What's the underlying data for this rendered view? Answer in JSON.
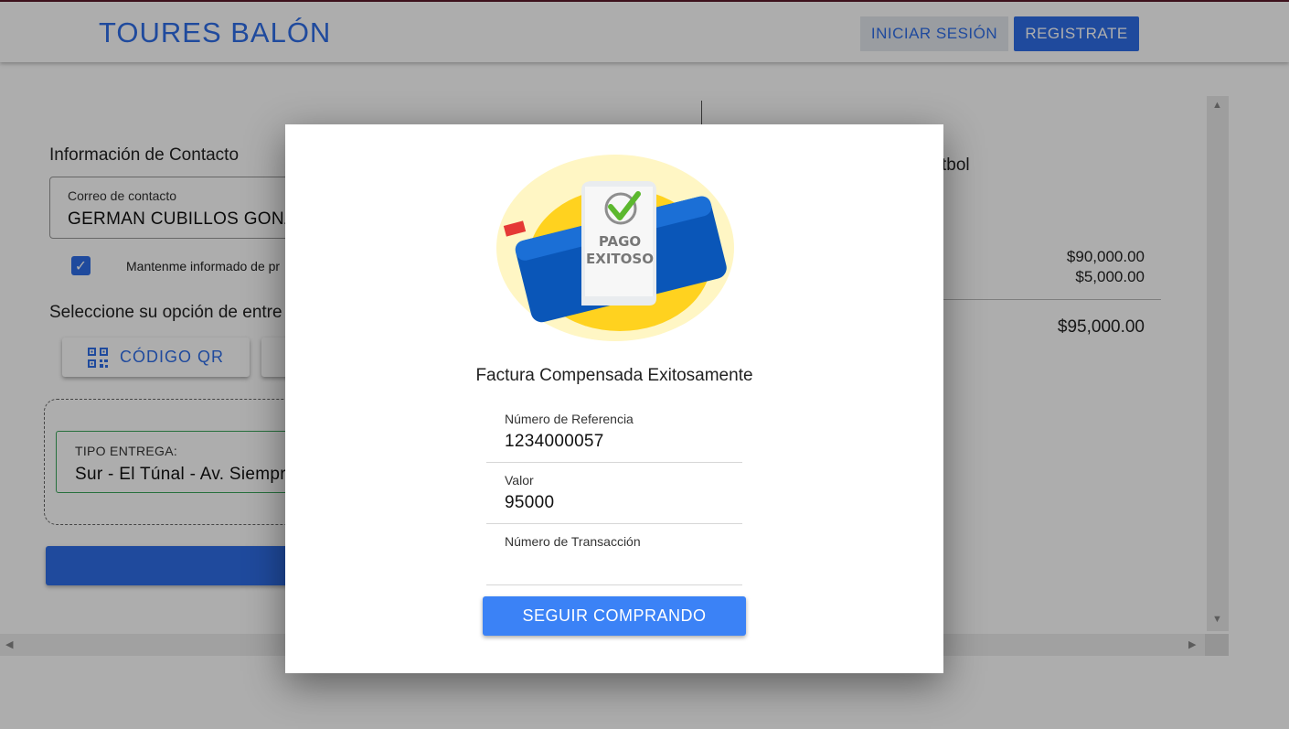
{
  "header": {
    "brand": "TOURES BALÓN",
    "login_label": "INICIAR SESIÓN",
    "register_label": "REGISTRATE"
  },
  "background": {
    "contact_title": "Información de Contacto",
    "email_label": "Correo de contacto",
    "email_value": "GERMAN CUBILLOS GONZ",
    "newsletter_label": "Mantenme informado de pr",
    "delivery_title": "Seleccione su opción de entre",
    "qr_button_label": "CÓDIGO QR",
    "delivery_type_label": "TIPO ENTREGA:",
    "delivery_type_value": "Sur - El Túnal - Av. Siempre",
    "summary_partial_text": "tbol",
    "price_1": "$90,000.00",
    "price_2": "$5,000.00",
    "total": "$95,000.00"
  },
  "modal": {
    "badge_line1": "PAGO",
    "badge_line2": "EXITOSO",
    "title": "Factura Compensada Exitosamente",
    "reference_label": "Número de Referencia",
    "reference_value": "1234000057",
    "amount_label": "Valor",
    "amount_value": "95000",
    "transaction_label": "Número de Transacción",
    "transaction_value": "",
    "continue_label": "SEGUIR COMPRANDO"
  },
  "colors": {
    "accent": "#2f6de8",
    "modal_button": "#3b82f6",
    "success_green": "#5cb82e"
  },
  "icons": [
    "qr-code-icon",
    "check-icon",
    "payment-success-illustration"
  ]
}
